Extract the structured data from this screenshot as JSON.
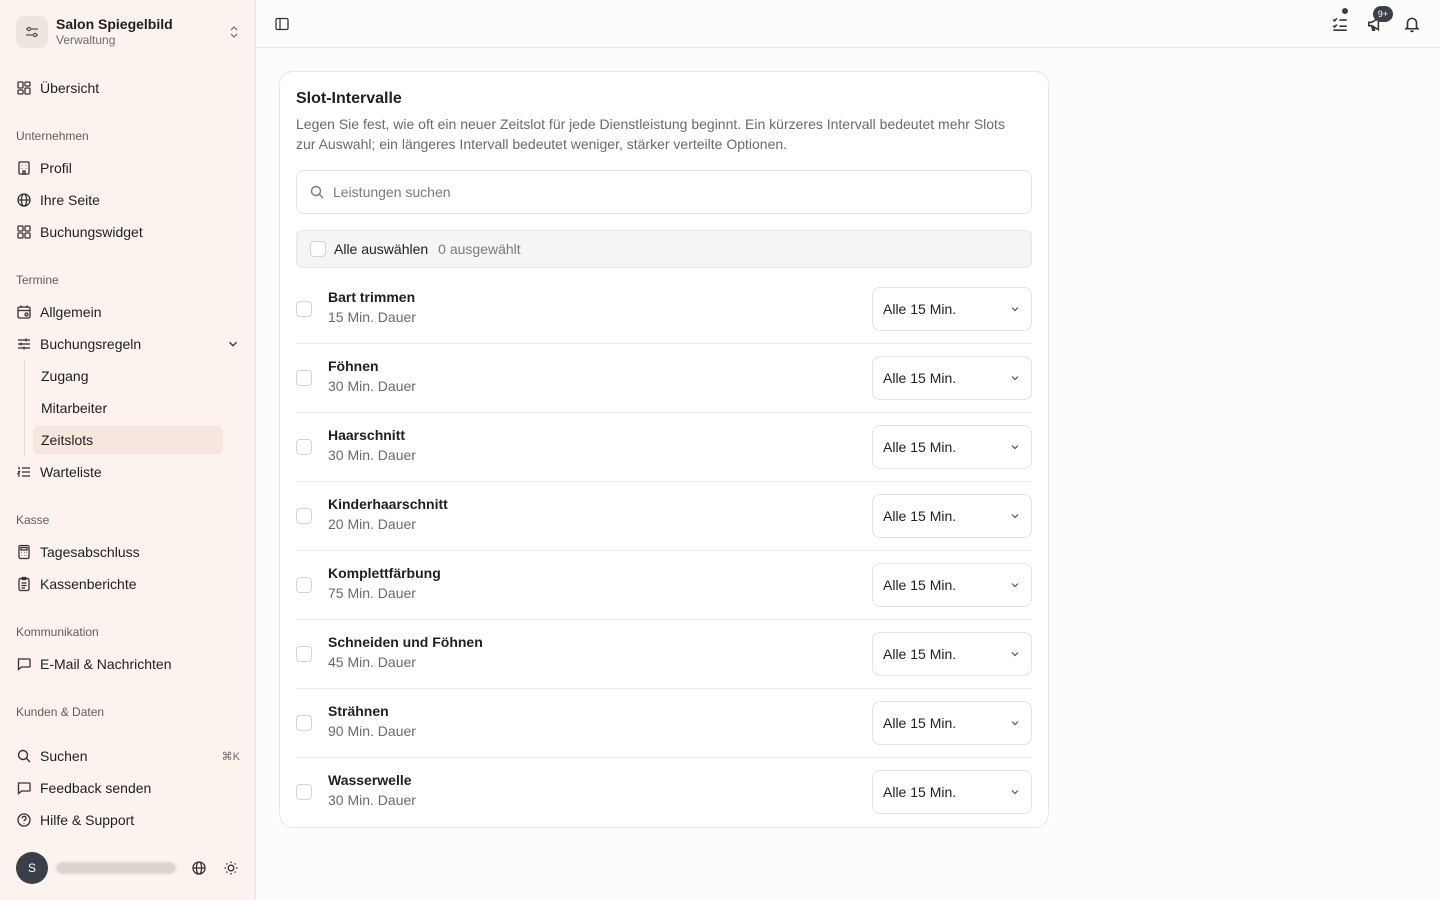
{
  "brand": {
    "name": "Salon Spiegelbild",
    "subtitle": "Verwaltung"
  },
  "sidebar": {
    "overview": "Übersicht",
    "group_company": "Unternehmen",
    "profile": "Profil",
    "your_page": "Ihre Seite",
    "booking_widget": "Buchungswidget",
    "group_appointments": "Termine",
    "general": "Allgemein",
    "booking_rules": "Buchungsregeln",
    "sub_access": "Zugang",
    "sub_staff": "Mitarbeiter",
    "sub_timeslots": "Zeitslots",
    "waitlist": "Warteliste",
    "group_register": "Kasse",
    "daily_closing": "Tagesabschluss",
    "register_reports": "Kassenberichte",
    "group_communication": "Kommunikation",
    "email_messages": "E-Mail & Nachrichten",
    "group_customers": "Kunden & Daten",
    "search": "Suchen",
    "search_shortcut": "⌘K",
    "feedback": "Feedback senden",
    "help": "Hilfe & Support"
  },
  "user": {
    "initial": "S"
  },
  "topbar": {
    "notifications_badge": "9+"
  },
  "card": {
    "title": "Slot-Intervalle",
    "description": "Legen Sie fest, wie oft ein neuer Zeitslot für jede Dienstleistung beginnt. Ein kürzeres Intervall bedeutet mehr Slots zur Auswahl; ein längeres Intervall bedeutet weniger, stärker verteilte Optionen.",
    "search_placeholder": "Leistungen suchen",
    "select_all": "Alle auswählen",
    "selected_count": "0 ausgewählt"
  },
  "services": [
    {
      "name": "Bart trimmen",
      "duration": "15 Min. Dauer",
      "interval": "Alle 15 Min."
    },
    {
      "name": "Föhnen",
      "duration": "30 Min. Dauer",
      "interval": "Alle 15 Min."
    },
    {
      "name": "Haarschnitt",
      "duration": "30 Min. Dauer",
      "interval": "Alle 15 Min."
    },
    {
      "name": "Kinderhaarschnitt",
      "duration": "20 Min. Dauer",
      "interval": "Alle 15 Min."
    },
    {
      "name": "Komplettfärbung",
      "duration": "75 Min. Dauer",
      "interval": "Alle 15 Min."
    },
    {
      "name": "Schneiden und Föhnen",
      "duration": "45 Min. Dauer",
      "interval": "Alle 15 Min."
    },
    {
      "name": "Strähnen",
      "duration": "90 Min. Dauer",
      "interval": "Alle 15 Min."
    },
    {
      "name": "Wasserwelle",
      "duration": "30 Min. Dauer",
      "interval": "Alle 15 Min."
    }
  ]
}
